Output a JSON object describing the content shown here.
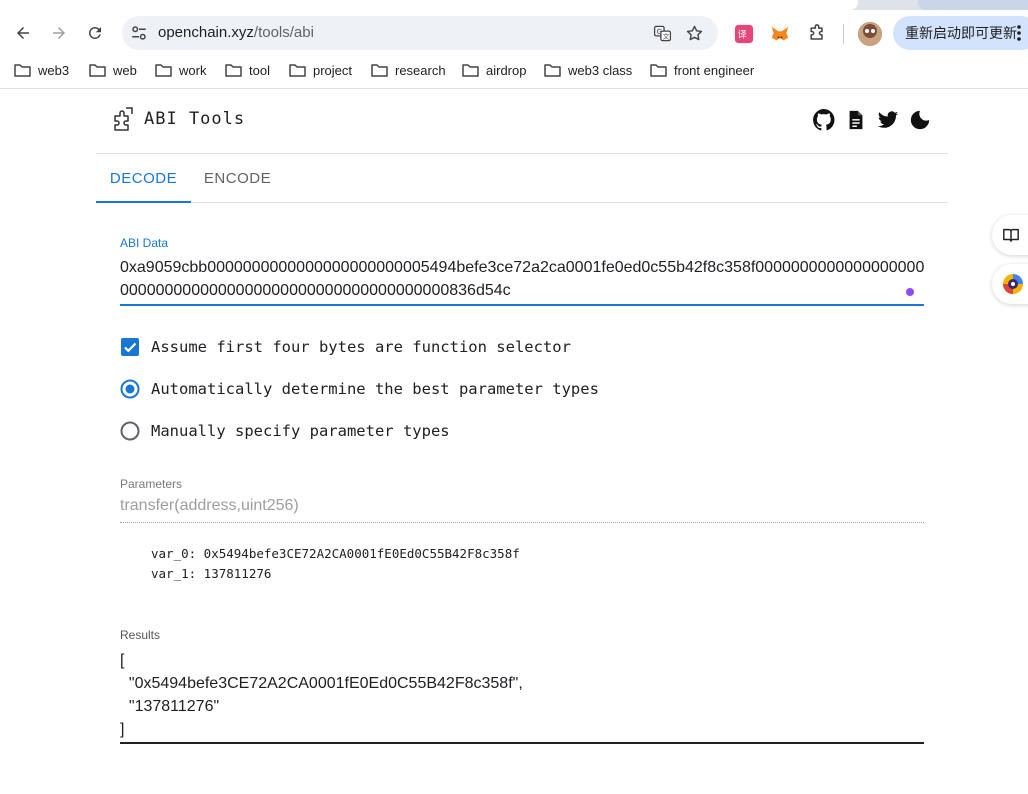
{
  "browser": {
    "url_domain": "openchain.xyz",
    "url_path": "/tools/abi",
    "update_button": "重新启动即可更新",
    "bookmarks": [
      "web3",
      "web",
      "work",
      "tool",
      "project",
      "research",
      "airdrop",
      "web3 class",
      "front engineer"
    ],
    "colors": {
      "accent": "#1976d2",
      "omnibox": "#eef1f6",
      "update_button": "#d3e3fd"
    }
  },
  "app": {
    "title": "ABI Tools",
    "header_icons": [
      "github-icon",
      "document-icon",
      "twitter-icon",
      "dark-mode-icon"
    ]
  },
  "tabs": [
    {
      "label": "DECODE",
      "active": true
    },
    {
      "label": "ENCODE",
      "active": false
    }
  ],
  "abi_data": {
    "label": "ABI Data",
    "value": "0xa9059cbb0000000000000000000000005494befe3ce72a2ca0001fe0ed0c55b42f8c358f00000000000000000000000000000000000000000000000000000000836d54c"
  },
  "options": {
    "assume_selector": {
      "label": "Assume first four bytes are function selector",
      "checked": true
    },
    "auto_types": {
      "label": "Automatically determine the best parameter types",
      "selected": true
    },
    "manual_types": {
      "label": "Manually specify parameter types",
      "selected": false
    }
  },
  "parameters": {
    "label": "Parameters",
    "value": "transfer(address,uint256)"
  },
  "decoded": {
    "var_0": "var_0: 0x5494befe3CE72A2CA0001fE0Ed0C55B42F8c358f",
    "var_1": "var_1: 137811276"
  },
  "results": {
    "label": "Results",
    "value": "[\n  \"0x5494befe3CE72A2CA0001fE0Ed0C55B42F8c358f\",\n  \"137811276\"\n]"
  }
}
